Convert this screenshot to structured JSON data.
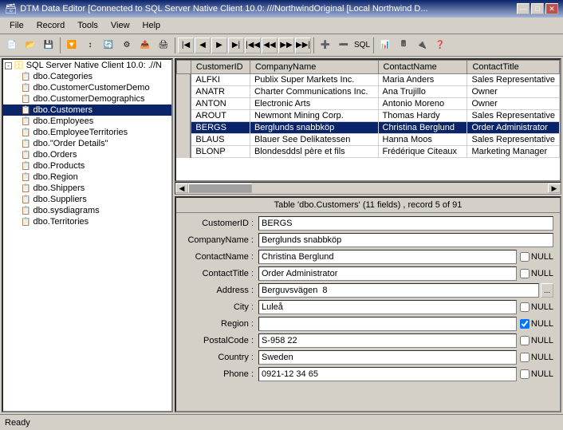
{
  "titleBar": {
    "title": "DTM Data Editor [Connected to SQL Server Native Client 10.0: ///NorthwindOriginal [Local Northwind D...",
    "minBtn": "—",
    "maxBtn": "□",
    "closeBtn": "✕"
  },
  "menuBar": {
    "items": [
      "File",
      "Record",
      "Tools",
      "View",
      "Help"
    ]
  },
  "tree": {
    "rootLabel": "SQL Server Native Client 10.0: .//N",
    "items": [
      "dbo.Categories",
      "dbo.CustomerCustomerDemo",
      "dbo.CustomerDemographics",
      "dbo.Customers",
      "dbo.Employees",
      "dbo.EmployeeTerritories",
      "dbo.\"Order Details\"",
      "dbo.Orders",
      "dbo.Products",
      "dbo.Region",
      "dbo.Shippers",
      "dbo.Suppliers",
      "dbo.sysdiagrams",
      "dbo.Territories"
    ],
    "selectedIndex": 3
  },
  "grid": {
    "columns": [
      "CustomerID",
      "CompanyName",
      "ContactName",
      "ContactTitle"
    ],
    "rows": [
      [
        "ALFKI",
        "Publix Super Markets Inc.",
        "Maria Anders",
        "Sales Representative"
      ],
      [
        "ANATR",
        "Charter Communications Inc.",
        "Ana Trujillo",
        "Owner"
      ],
      [
        "ANTON",
        "Electronic Arts",
        "Antonio Moreno",
        "Owner"
      ],
      [
        "AROUT",
        "Newmont Mining Corp.",
        "Thomas Hardy",
        "Sales Representative"
      ],
      [
        "BERGS",
        "Berglunds snabbköp",
        "Christina Berglund",
        "Order Administrator"
      ],
      [
        "BLAUS",
        "Blauer See Delikatessen",
        "Hanna Moos",
        "Sales Representative"
      ],
      [
        "BLONP",
        "Blondesddsl père et fils",
        "Frédérique Citeaux",
        "Marketing Manager"
      ]
    ],
    "selectedRowIndex": 4
  },
  "detailHeader": "Table 'dbo.Customers' (11 fields) , record 5 of 91",
  "detailFields": [
    {
      "label": "CustomerID :",
      "value": "BERGS",
      "hasNull": false,
      "hasExpand": false,
      "nullChecked": false
    },
    {
      "label": "CompanyName :",
      "value": "Berglunds snabbköp",
      "hasNull": false,
      "hasExpand": false,
      "nullChecked": false
    },
    {
      "label": "ContactName :",
      "value": "Christina Berglund",
      "hasNull": true,
      "hasExpand": false,
      "nullChecked": false
    },
    {
      "label": "ContactTitle :",
      "value": "Order Administrator",
      "hasNull": true,
      "hasExpand": false,
      "nullChecked": false
    },
    {
      "label": "Address :",
      "value": "Berguvsvägen  8",
      "hasNull": false,
      "hasExpand": true,
      "nullChecked": false
    },
    {
      "label": "City :",
      "value": "Luleå",
      "hasNull": true,
      "hasExpand": false,
      "nullChecked": false
    },
    {
      "label": "Region :",
      "value": "",
      "hasNull": true,
      "hasExpand": false,
      "nullChecked": true
    },
    {
      "label": "PostalCode :",
      "value": "S-958 22",
      "hasNull": true,
      "hasExpand": false,
      "nullChecked": false
    },
    {
      "label": "Country :",
      "value": "Sweden",
      "hasNull": true,
      "hasExpand": false,
      "nullChecked": false
    },
    {
      "label": "Phone :",
      "value": "0921-12 34 65",
      "hasNull": true,
      "hasExpand": false,
      "nullChecked": false
    }
  ],
  "statusBar": {
    "text": "Ready"
  }
}
